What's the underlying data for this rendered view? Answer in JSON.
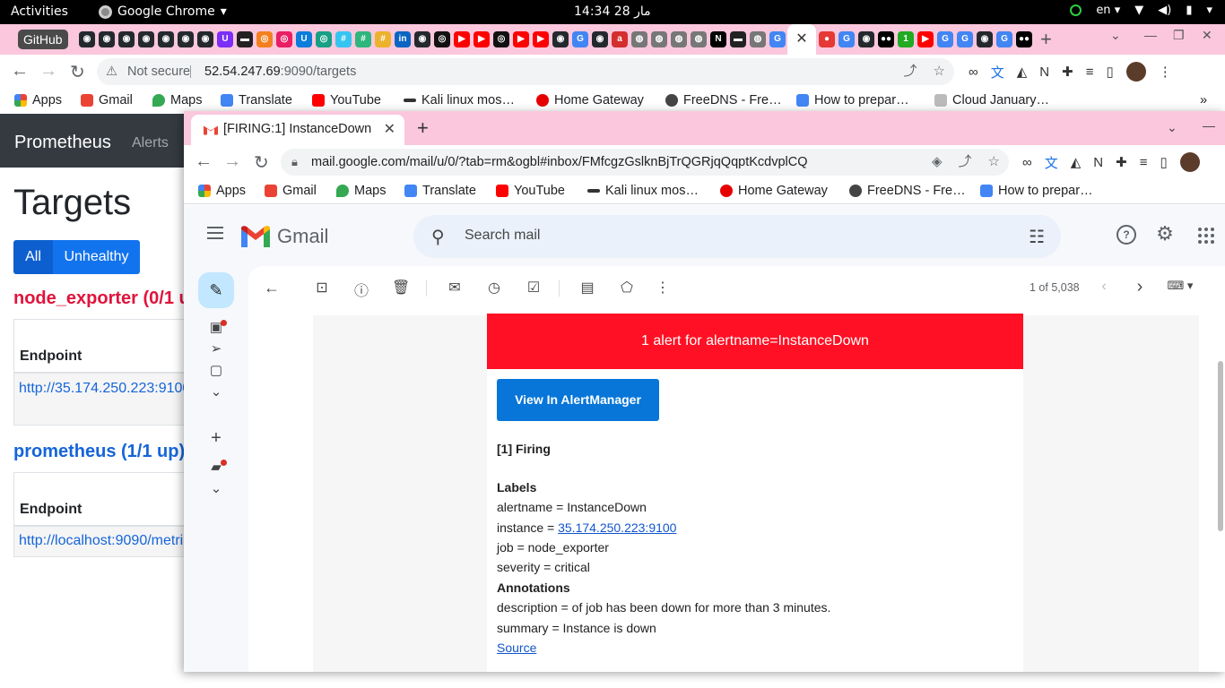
{
  "system": {
    "activities": "Activities",
    "app_name": "Google Chrome",
    "clock": "14:34  28 مار",
    "lang": "en"
  },
  "back_window": {
    "github_chip": "GitHub",
    "url_warning": "Not secure",
    "url_host": "52.54.247.69",
    "url_path": ":9090/targets",
    "bookmarks": [
      "Apps",
      "Gmail",
      "Maps",
      "Translate",
      "YouTube",
      "Kali linux mos…",
      "Home Gateway",
      "FreeDNS - Fre…",
      "How to prepar…",
      "Cloud January…"
    ],
    "bookmark_overflow": "»"
  },
  "prometheus": {
    "brand": "Prometheus",
    "nav_alerts": "Alerts",
    "title": "Targets",
    "filter_all": "All",
    "filter_unhealthy": "Unhealthy",
    "pools": [
      {
        "title": "node_exporter (0/1 u",
        "header": "Endpoint",
        "endpoint": "http://35.174.250.223:9100"
      },
      {
        "title": "prometheus (1/1 up)",
        "header": "Endpoint",
        "endpoint": "http://localhost:9090/metri"
      }
    ]
  },
  "front_window": {
    "tab_title": "[FIRING:1] InstanceDown",
    "url": "mail.google.com/mail/u/0/?tab=rm&ogbl#inbox/FMfcgzGslknBjTrQGRjqQqptKcdvplCQ",
    "bookmarks": [
      "Apps",
      "Gmail",
      "Maps",
      "Translate",
      "YouTube",
      "Kali linux mos…",
      "Home Gateway",
      "FreeDNS - Fre…",
      "How to prepar…"
    ]
  },
  "gmail": {
    "brand": "Gmail",
    "search_placeholder": "Search mail",
    "message_count": "1 of 5,038"
  },
  "email": {
    "header": "1 alert for alertname=InstanceDown",
    "button": "View In AlertManager",
    "firing": "[1] Firing",
    "labels_heading": "Labels",
    "alertname": "alertname = InstanceDown",
    "instance_prefix": "instance = ",
    "instance_link": "35.174.250.223:9100",
    "job": "job = node_exporter",
    "severity": "severity = critical",
    "annotations_heading": "Annotations",
    "description": "description = of job has been down for more than 3 minutes.",
    "summary": "summary = Instance is down",
    "source": "Source"
  },
  "colors": {
    "tab_strip": "#fbc7dc",
    "alert_red": "#ff1024",
    "alert_button": "#0776d8",
    "prom_red": "#e0143c",
    "prom_blue": "#1565d8"
  }
}
